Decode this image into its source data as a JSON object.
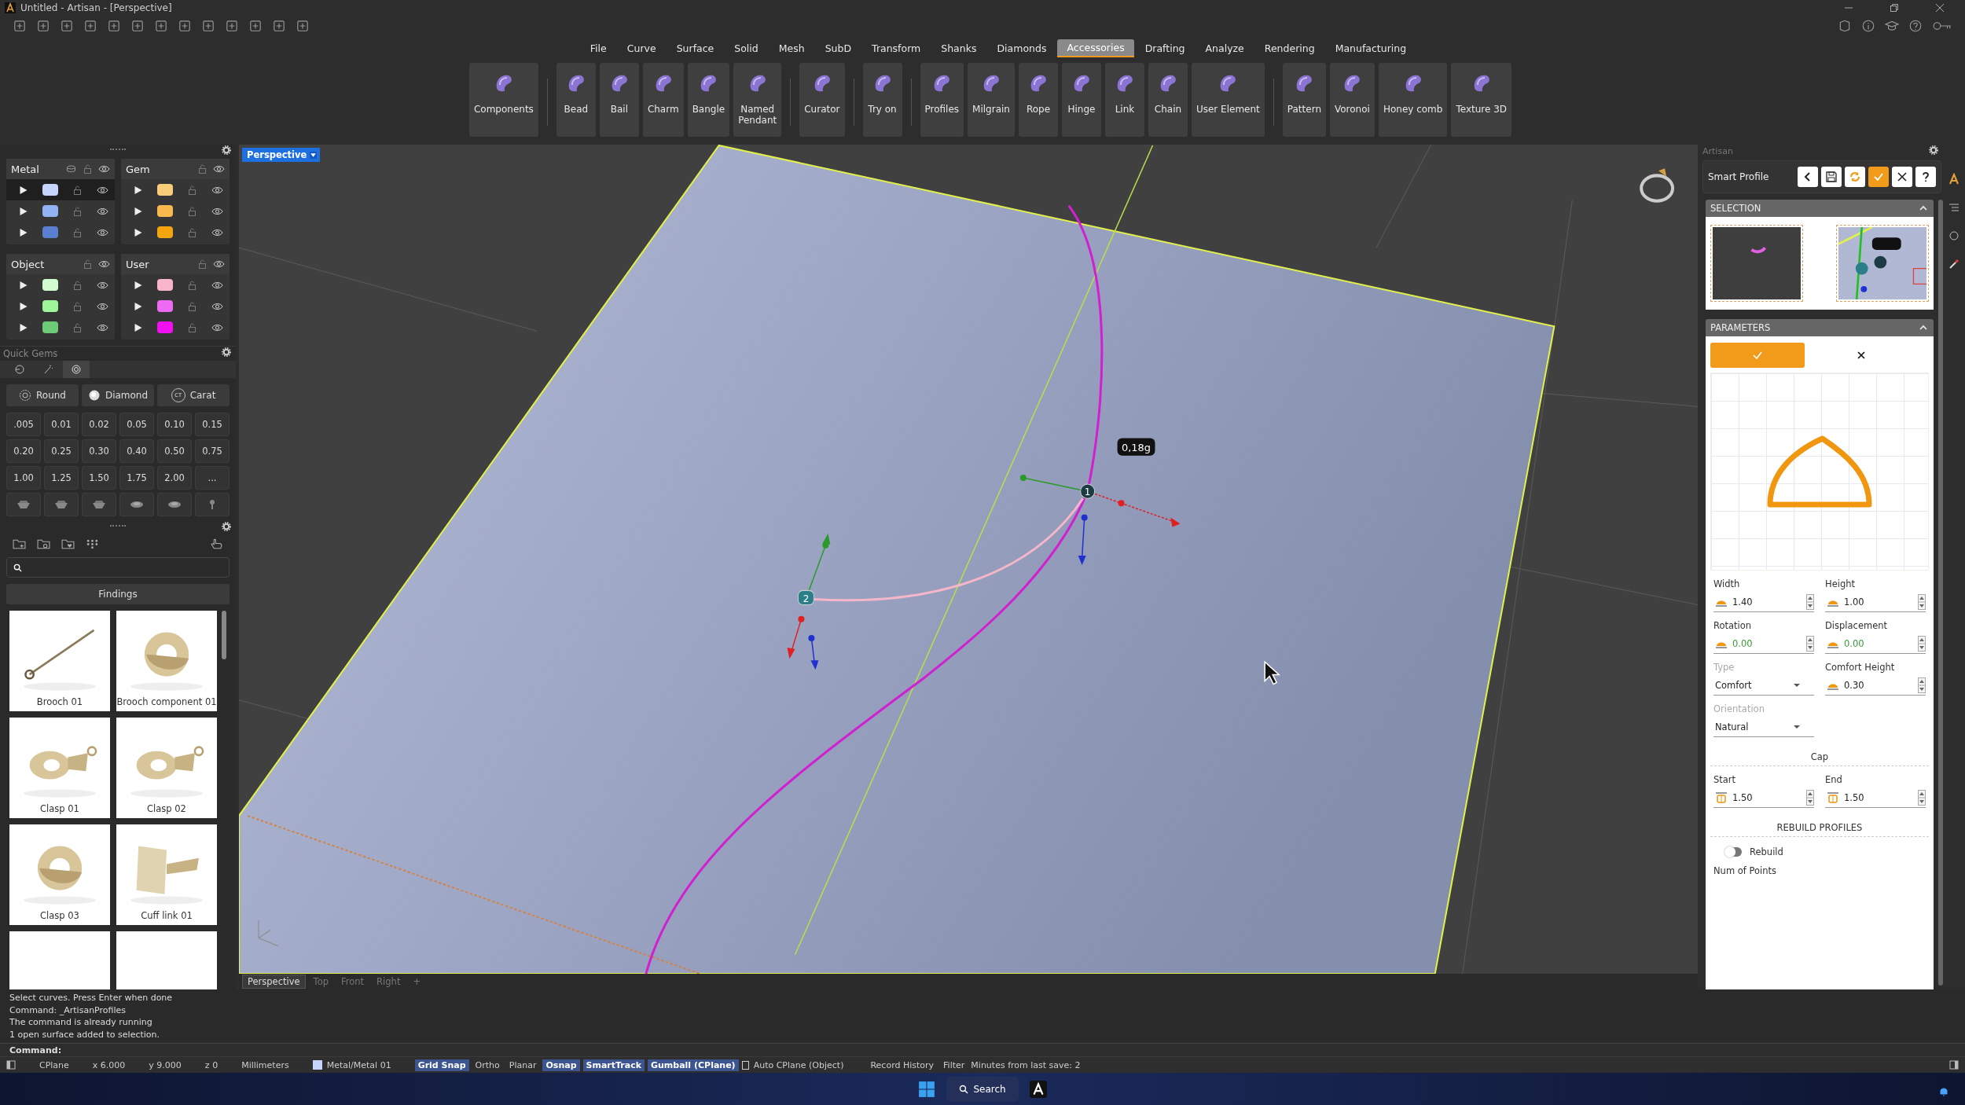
{
  "window": {
    "title": "Untitled - Artisan - [Perspective]"
  },
  "menu": [
    {
      "label": "File",
      "selected": false
    },
    {
      "label": "Curve",
      "selected": false
    },
    {
      "label": "Surface",
      "selected": false
    },
    {
      "label": "Solid",
      "selected": false
    },
    {
      "label": "Mesh",
      "selected": false
    },
    {
      "label": "SubD",
      "selected": false
    },
    {
      "label": "Transform",
      "selected": false
    },
    {
      "label": "Shanks",
      "selected": false
    },
    {
      "label": "Diamonds",
      "selected": false
    },
    {
      "label": "Accessories",
      "selected": true
    },
    {
      "label": "Drafting",
      "selected": false
    },
    {
      "label": "Analyze",
      "selected": false
    },
    {
      "label": "Rendering",
      "selected": false
    },
    {
      "label": "Manufacturing",
      "selected": false
    }
  ],
  "ribbon": [
    [
      {
        "label": "Components"
      }
    ],
    [
      {
        "label": "Bead"
      },
      {
        "label": "Bail"
      },
      {
        "label": "Charm"
      },
      {
        "label": "Bangle"
      },
      {
        "label": "Named\nPendant"
      }
    ],
    [
      {
        "label": "Curator"
      }
    ],
    [
      {
        "label": "Try on"
      }
    ],
    [
      {
        "label": "Profiles"
      },
      {
        "label": "Milgrain"
      },
      {
        "label": "Rope"
      },
      {
        "label": "Hinge"
      },
      {
        "label": "Link"
      },
      {
        "label": "Chain"
      },
      {
        "label": "User Element"
      }
    ],
    [
      {
        "label": "Pattern"
      },
      {
        "label": "Voronoi"
      },
      {
        "label": "Honey comb"
      },
      {
        "label": "Texture 3D"
      }
    ]
  ],
  "layer_groups": [
    {
      "title": "Metal",
      "kind": "material",
      "layers": [
        {
          "color": "#c6d4fb",
          "selected": true
        },
        {
          "color": "#92b2f3",
          "selected": false
        },
        {
          "color": "#5b7fd0",
          "selected": false
        }
      ]
    },
    {
      "title": "Gem",
      "kind": "plain",
      "layers": [
        {
          "color": "#f9cc7a",
          "selected": false
        },
        {
          "color": "#f8b84e",
          "selected": false
        },
        {
          "color": "#f4a40f",
          "selected": false
        }
      ]
    },
    {
      "title": "Object",
      "kind": "plain",
      "layers": [
        {
          "color": "#d2fbd0",
          "selected": false
        },
        {
          "color": "#9ef59a",
          "selected": false
        },
        {
          "color": "#6ccb76",
          "selected": false
        }
      ]
    },
    {
      "title": "User",
      "kind": "plain",
      "layers": [
        {
          "color": "#f7b4cb",
          "selected": false
        },
        {
          "color": "#ee6af3",
          "selected": false
        },
        {
          "color": "#f010f0",
          "selected": false
        }
      ]
    }
  ],
  "quick_gems": {
    "title": "Quick Gems",
    "tabs": [
      {
        "kind": "gem-pick",
        "selected": false
      },
      {
        "kind": "wand",
        "selected": false
      },
      {
        "kind": "round",
        "selected": true
      }
    ],
    "dropdowns": [
      {
        "label": "Round",
        "kind": "round"
      },
      {
        "label": "Diamond",
        "kind": "diamond"
      },
      {
        "label": "Carat",
        "kind": "carat",
        "icon_text": "CT"
      }
    ],
    "sizes": [
      ".005",
      "0.01",
      "0.02",
      "0.05",
      "0.10",
      "0.15",
      "0.20",
      "0.25",
      "0.30",
      "0.40",
      "0.50",
      "0.75",
      "1.00",
      "1.25",
      "1.50",
      "1.75",
      "2.00",
      "..."
    ],
    "cuts": [
      {
        "kind": "round"
      },
      {
        "kind": "round"
      },
      {
        "kind": "round"
      },
      {
        "kind": "flat"
      },
      {
        "kind": "flat"
      },
      {
        "kind": "setting"
      }
    ]
  },
  "library": {
    "category": "Findings",
    "items": [
      {
        "label": "Brooch 01",
        "kind": "pin"
      },
      {
        "label": "Brooch component 01",
        "kind": "ring"
      },
      {
        "label": "Clasp 01",
        "kind": "clasp"
      },
      {
        "label": "Clasp 02",
        "kind": "clasp"
      },
      {
        "label": "Clasp 03",
        "kind": "ring"
      },
      {
        "label": "Cuff link 01",
        "kind": "cuff"
      },
      {
        "kind": "blank"
      },
      {
        "kind": "blank"
      }
    ]
  },
  "viewport": {
    "title": "Perspective",
    "tooltip": "0,18g",
    "points": [
      "1",
      "2"
    ],
    "tabs": [
      {
        "label": "Perspective",
        "selected": true
      },
      {
        "label": "Top",
        "selected": false
      },
      {
        "label": "Front",
        "selected": false
      },
      {
        "label": "Right",
        "selected": false
      },
      {
        "label": "+",
        "selected": false
      }
    ]
  },
  "panel": {
    "title": "Artisan",
    "tool": "Smart Profile",
    "tool_buttons": [
      {
        "kind": "back"
      },
      {
        "kind": "save"
      },
      {
        "kind": "refresh"
      },
      {
        "kind": "confirm"
      },
      {
        "kind": "close"
      },
      {
        "kind": "help"
      }
    ],
    "selection": {
      "title": "SELECTION",
      "expanded": true
    },
    "parameters": {
      "title": "PARAMETERS",
      "expanded": true,
      "rows": [
        [
          {
            "label": "Width",
            "value": "1.40",
            "kind": "spin",
            "disabled": false,
            "color": "#222222"
          },
          {
            "label": "Height",
            "value": "1.00",
            "kind": "spin",
            "disabled": false,
            "color": "#222222"
          }
        ],
        [
          {
            "label": "Rotation",
            "value": "0.00",
            "kind": "spin",
            "disabled": false,
            "color": "#3a9a3a"
          },
          {
            "label": "Displacement",
            "value": "0.00",
            "kind": "spin",
            "disabled": false,
            "color": "#3a9a3a"
          }
        ],
        [
          {
            "label": "Type",
            "value": "Comfort",
            "kind": "dropdown",
            "disabled": true,
            "color": "#222222"
          },
          {
            "label": "Comfort Height",
            "value": "0.30",
            "kind": "spin",
            "disabled": false,
            "color": "#222222"
          }
        ],
        [
          {
            "label": "Orientation",
            "value": "Natural",
            "kind": "dropdown",
            "disabled": true,
            "color": "#222222"
          }
        ]
      ],
      "cap": {
        "title": "Cap",
        "fields": [
          {
            "label": "Start",
            "value": "1.50",
            "kind": "spin",
            "disabled": false,
            "color": "#222222"
          },
          {
            "label": "End",
            "value": "1.50",
            "kind": "spin",
            "disabled": false,
            "color": "#222222"
          }
        ]
      },
      "rebuild": {
        "title": "REBUILD PROFILES",
        "label": "Rebuild",
        "on": false
      },
      "num_points": "Num of Points"
    }
  },
  "history": [
    "Select curves. Press Enter when done",
    "Command: _ArtisanProfiles",
    "The command is already running",
    "1 open surface added to selection."
  ],
  "command": "Command:",
  "status_bar": [
    {
      "kind": "text",
      "label": "CPlane"
    },
    {
      "kind": "text",
      "label": "x 6.000"
    },
    {
      "kind": "text",
      "label": "y 9.000"
    },
    {
      "kind": "text",
      "label": "z 0"
    },
    {
      "kind": "text",
      "label": "Millimeters"
    },
    {
      "kind": "layer",
      "label": "Metal/Metal 01",
      "color": "#c6d4fb"
    },
    {
      "kind": "toggle",
      "label": "Grid Snap",
      "on": true
    },
    {
      "kind": "toggle",
      "label": "Ortho",
      "on": false
    },
    {
      "kind": "toggle",
      "label": "Planar",
      "on": false
    },
    {
      "kind": "toggle",
      "label": "Osnap",
      "on": true
    },
    {
      "kind": "toggle",
      "label": "SmartTrack",
      "on": true
    },
    {
      "kind": "toggle",
      "label": "Gumball (CPlane)",
      "on": true
    },
    {
      "kind": "check",
      "label": "Auto CPlane (Object)",
      "on": false
    },
    {
      "kind": "toggle",
      "label": "Record History",
      "on": false
    },
    {
      "kind": "toggle",
      "label": "Filter",
      "on": false
    },
    {
      "kind": "text",
      "label": "Minutes from last save: 2"
    }
  ],
  "taskbar": {
    "search": "Search"
  }
}
